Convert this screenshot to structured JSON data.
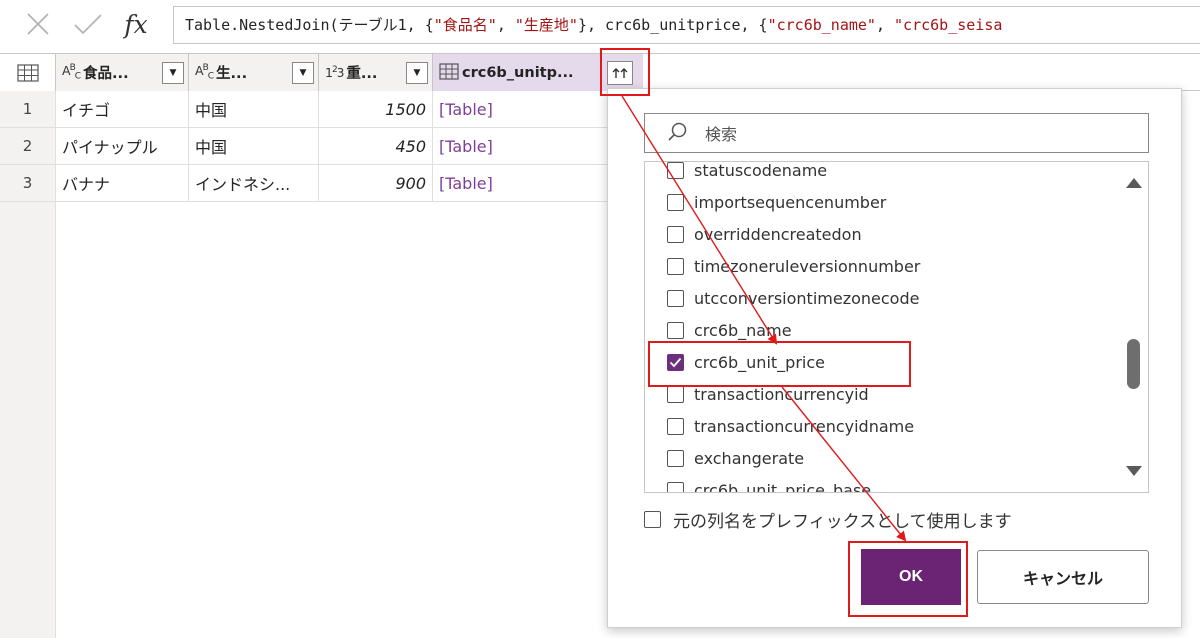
{
  "formula_bar": {
    "cancel_icon": "close-icon",
    "accept_icon": "check-icon",
    "fx_label": "fx",
    "formula_prefix": "Table.NestedJoin(テーブル1, {",
    "formula_str1": "\"食品名\"",
    "formula_sep1": ", ",
    "formula_str2": "\"生産地\"",
    "formula_mid": "}, crc6b_unitprice, {",
    "formula_str3": "\"crc6b_name\"",
    "formula_sep2": ", ",
    "formula_str4": "\"crc6b_seisa"
  },
  "grid": {
    "columns": [
      {
        "type_icon": "ABC",
        "label": "食品..."
      },
      {
        "type_icon": "ABC",
        "label": "生..."
      },
      {
        "type_icon": "123",
        "label": "重..."
      },
      {
        "type_icon": "table-icon",
        "label": "crc6b_unitp..."
      }
    ],
    "rows": [
      {
        "num": "1",
        "food": "イチゴ",
        "origin": "中国",
        "weight": "1500",
        "ref": "[Table]"
      },
      {
        "num": "2",
        "food": "パイナップル",
        "origin": "中国",
        "weight": "450",
        "ref": "[Table]"
      },
      {
        "num": "3",
        "food": "バナナ",
        "origin": "インドネシ...",
        "weight": "900",
        "ref": "[Table]"
      }
    ]
  },
  "popup": {
    "search_placeholder": "検索",
    "items": [
      {
        "label": "statuscodename",
        "checked": false
      },
      {
        "label": "importsequencenumber",
        "checked": false
      },
      {
        "label": "overriddencreatedon",
        "checked": false
      },
      {
        "label": "timezoneruleversionnumber",
        "checked": false
      },
      {
        "label": "utcconversiontimezonecode",
        "checked": false
      },
      {
        "label": "crc6b_name",
        "checked": false
      },
      {
        "label": "crc6b_unit_price",
        "checked": true
      },
      {
        "label": "transactioncurrencyid",
        "checked": false
      },
      {
        "label": "transactioncurrencyidname",
        "checked": false
      },
      {
        "label": "exchangerate",
        "checked": false
      },
      {
        "label": "crc6b_unit_price_base",
        "checked": false
      }
    ],
    "prefix_label": "元の列名をプレフィックスとして使用します",
    "ok_label": "OK",
    "cancel_label": "キャンセル"
  },
  "colors": {
    "accent": "#6b2474",
    "annotation": "#e01a1a",
    "table_link": "#7f3f98",
    "column_highlight": "#e5d9ec"
  }
}
